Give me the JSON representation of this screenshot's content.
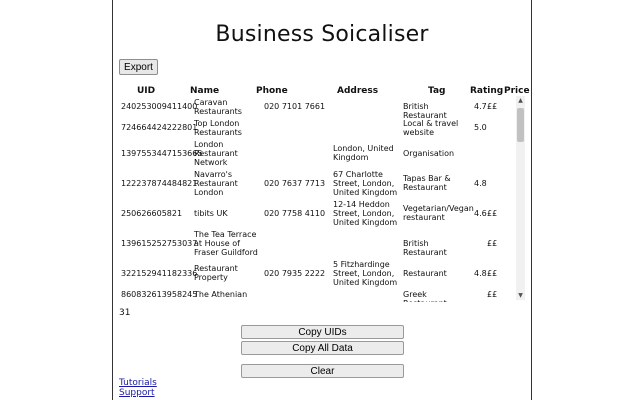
{
  "title": "Business Soicaliser",
  "export_label": "Export",
  "columns": [
    "UID",
    "Name",
    "Phone",
    "Address",
    "Tag",
    "Rating",
    "Price"
  ],
  "rows": [
    {
      "uid": "240253009411400",
      "name": "Caravan Restaurants",
      "phone": "020 7101 7661",
      "address": "",
      "tag": "British Restaurant",
      "rating": "4.7",
      "price": "££"
    },
    {
      "uid": "724664424222801",
      "name": "Top London Restaurants",
      "phone": "",
      "address": "",
      "tag": "Local & travel website",
      "rating": "5.0",
      "price": ""
    },
    {
      "uid": "1397553447153665",
      "name": "London Restaurant Network",
      "phone": "",
      "address": "London, United Kingdom",
      "tag": "Organisation",
      "rating": "",
      "price": ""
    },
    {
      "uid": "122237874484821",
      "name": "Navarro's Restaurant London",
      "phone": "020 7637 7713",
      "address": "67 Charlotte Street, London, United Kingdom",
      "tag": "Tapas Bar & Restaurant",
      "rating": "4.8",
      "price": ""
    },
    {
      "uid": "250626605821",
      "name": "tibits UK",
      "phone": "020 7758 4110",
      "address": "12-14 Heddon Street, London, United Kingdom",
      "tag": "Vegetarian/Vegan restaurant",
      "rating": "4.6",
      "price": "££"
    },
    {
      "uid": "139615252753037",
      "name": "The Tea Terrace at House of Fraser Guildford",
      "phone": "",
      "address": "",
      "tag": "British Restaurant",
      "rating": "",
      "price": "££"
    },
    {
      "uid": "322152941182336",
      "name": "Restaurant Property",
      "phone": "020 7935 2222",
      "address": "5 Fitzhardinge Street, London, United Kingdom",
      "tag": "Restaurant",
      "rating": "4.8",
      "price": "££"
    },
    {
      "uid": "860832613958245",
      "name": "The Athenian",
      "phone": "",
      "address": "",
      "tag": "Greek Restaurant",
      "rating": "",
      "price": "££"
    }
  ],
  "count": "31",
  "buttons": {
    "copy_uids": "Copy UIDs",
    "copy_all": "Copy All Data",
    "clear": "Clear"
  },
  "links": {
    "tutorials": "Tutorials",
    "support": "Support"
  },
  "scroll": {
    "up_icon": "▲",
    "down_icon": "▼"
  }
}
